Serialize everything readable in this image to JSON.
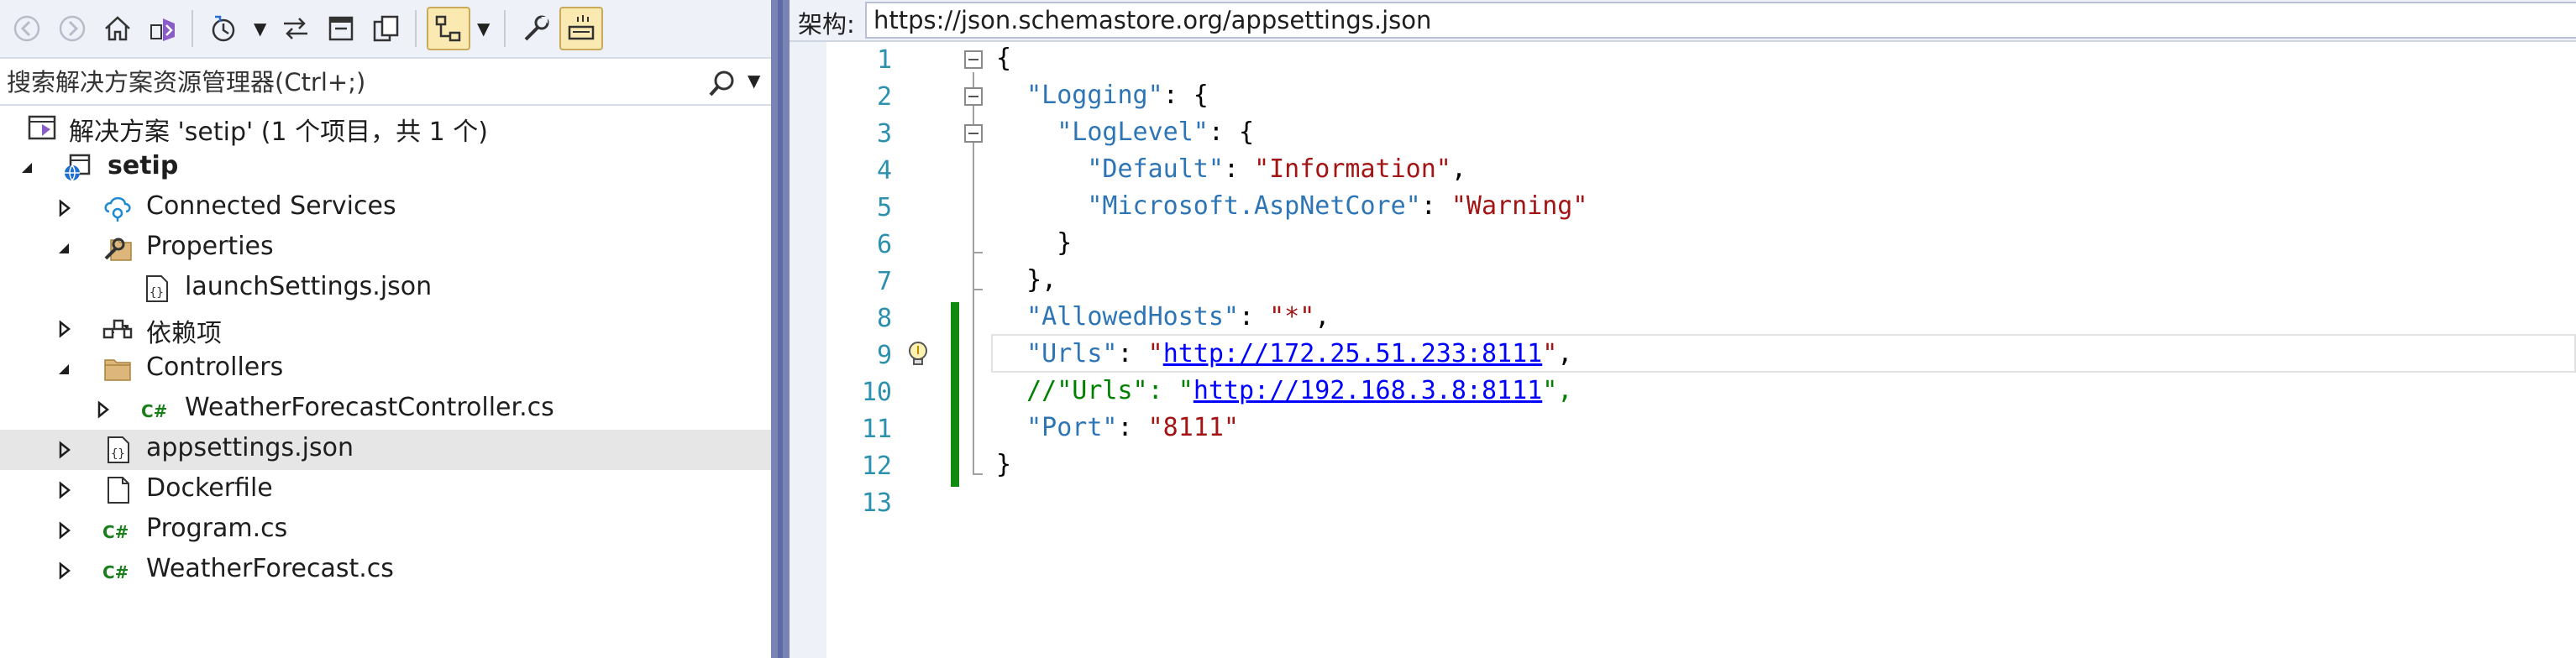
{
  "explorer": {
    "search_placeholder": "搜索解决方案资源管理器(Ctrl+;)",
    "solution_label": "解决方案 'setip' (1 个项目，共 1 个)",
    "project_label": "setip",
    "items": [
      {
        "label": "Connected Services"
      },
      {
        "label": "Properties"
      },
      {
        "label": "launchSettings.json"
      },
      {
        "label": "依赖项"
      },
      {
        "label": "Controllers"
      },
      {
        "label": "WeatherForecastController.cs"
      },
      {
        "label": "appsettings.json"
      },
      {
        "label": "Dockerfile"
      },
      {
        "label": "Program.cs"
      },
      {
        "label": "WeatherForecast.cs"
      }
    ],
    "selected_item": "appsettings.json"
  },
  "editor": {
    "schema_label": "架构:",
    "schema_url": "https://json.schemastore.org/appsettings.json",
    "line_numbers": [
      "1",
      "2",
      "3",
      "4",
      "5",
      "6",
      "7",
      "8",
      "9",
      "10",
      "11",
      "12",
      "13"
    ],
    "lines": {
      "l1": "{",
      "l2_key": "\"Logging\"",
      "l2_rest": ": {",
      "l3_key": "\"LogLevel\"",
      "l3_rest": ": {",
      "l4_key": "\"Default\"",
      "l4_mid": ": ",
      "l4_val": "\"Information\"",
      "l4_end": ",",
      "l5_key": "\"Microsoft.AspNetCore\"",
      "l5_mid": ": ",
      "l5_val": "\"Warning\"",
      "l6": "}",
      "l7": "},",
      "l8_key": "\"AllowedHosts\"",
      "l8_mid": ": ",
      "l8_val": "\"*\"",
      "l8_end": ",",
      "l9_key": "\"Urls\"",
      "l9_mid": ": ",
      "l9_q1": "\"",
      "l9_url": "http://172.25.51.233:8111",
      "l9_q2": "\"",
      "l9_end": ",",
      "l10_cmt1": "//\"Urls\": \"",
      "l10_url": "http://192.168.3.8:8111",
      "l10_cmt2": "\",",
      "l11_key": "\"Port\"",
      "l11_mid": ": ",
      "l11_val": "\"8111\"",
      "l12": "}"
    }
  },
  "colors": {
    "key": "#2e75b6",
    "string": "#a31515",
    "link": "#0000ff",
    "comment": "#008000",
    "line_number": "#2b91af",
    "change_bar": "#0f8a0f",
    "splitter": "#7983b5",
    "toolbar_bg": "#eef1f8"
  },
  "icons": {
    "toolbar": [
      "back-icon",
      "forward-icon",
      "home-icon",
      "vs-switch-views-icon",
      "history-icon",
      "sync-icon",
      "collapse-all-icon",
      "copy-icon",
      "show-tree-icon",
      "properties-wrench-icon",
      "preview-icon"
    ]
  }
}
